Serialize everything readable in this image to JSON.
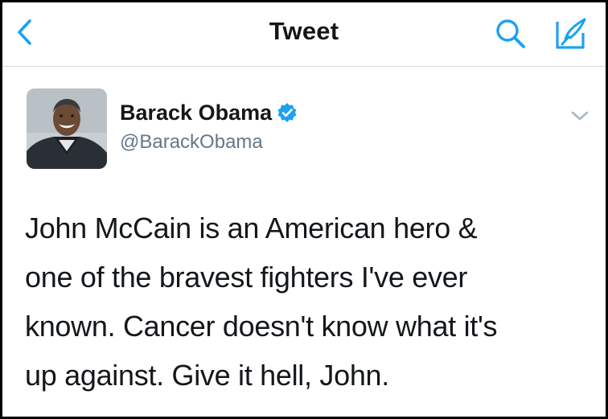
{
  "navbar": {
    "title": "Tweet",
    "back_icon": "chevron-left-icon",
    "search_icon": "search-icon",
    "compose_icon": "compose-tweet-icon"
  },
  "tweet": {
    "author": {
      "display_name": "Barack Obama",
      "handle": "@BarackObama",
      "verified": true,
      "avatar_icon": "profile-photo"
    },
    "menu_icon": "chevron-down-icon",
    "text_lines": [
      "John McCain is an American hero &",
      "one of the bravest fighters I've ever",
      "known. Cancer doesn't know what it's",
      "up against. Give it hell, John."
    ]
  },
  "colors": {
    "accent": "#1da1f2",
    "verified": "#1da1f2",
    "text_primary": "#14171a",
    "text_secondary": "#657786",
    "divider": "#d7dbdf",
    "frame_border": "#000000"
  }
}
